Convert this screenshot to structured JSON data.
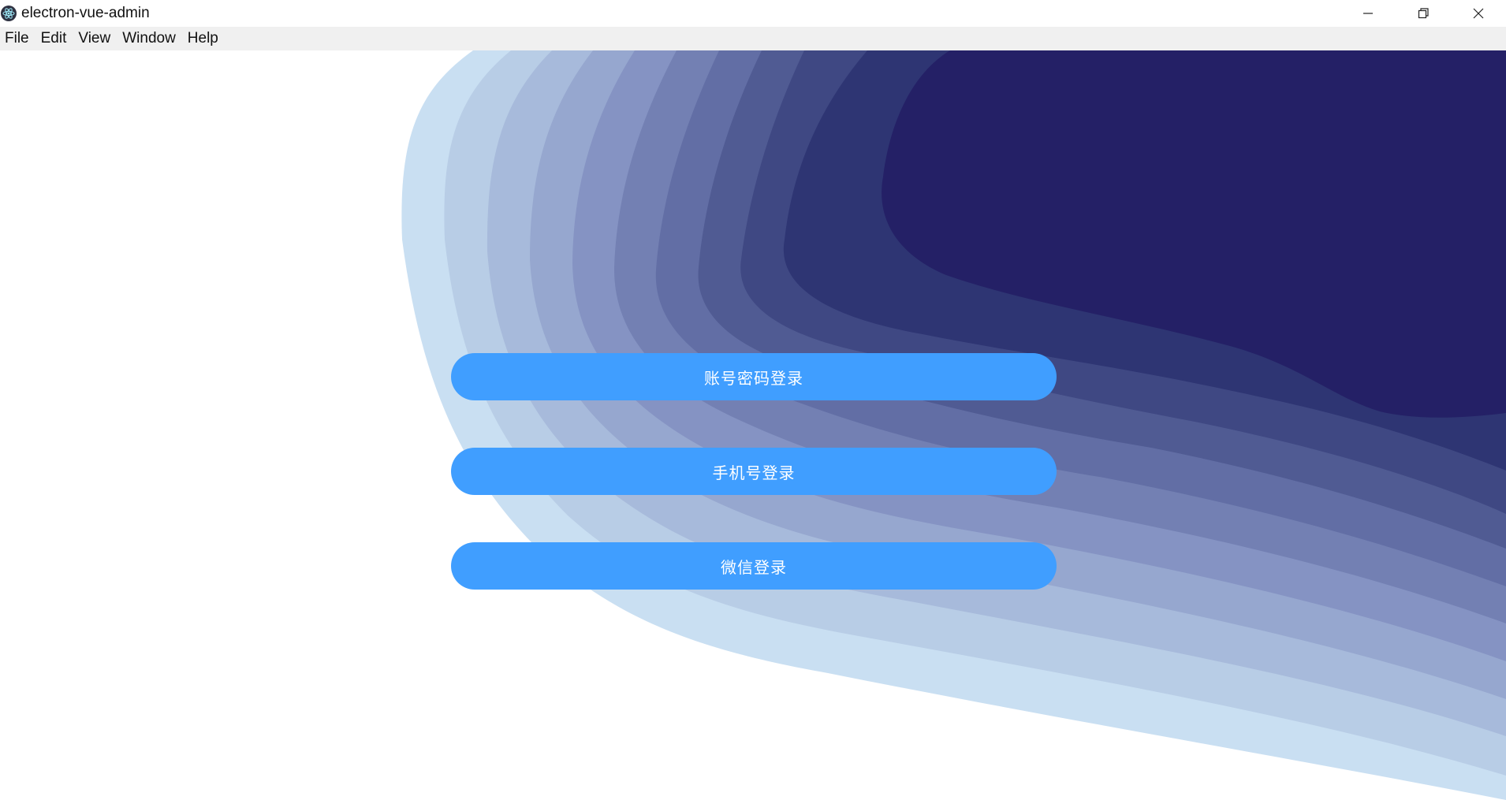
{
  "window": {
    "title": "electron-vue-admin",
    "app_icon": "electron-icon",
    "controls": {
      "minimize_icon": "minimize-icon",
      "restore_icon": "restore-icon",
      "close_icon": "close-icon"
    }
  },
  "menubar": {
    "items": [
      {
        "label": "File"
      },
      {
        "label": "Edit"
      },
      {
        "label": "View"
      },
      {
        "label": "Window"
      },
      {
        "label": "Help"
      }
    ]
  },
  "login": {
    "buttons": [
      {
        "label": "账号密码登录"
      },
      {
        "label": "手机号登录"
      },
      {
        "label": "微信登录"
      }
    ]
  },
  "colors": {
    "button": "#409eff",
    "wave_layers": [
      "#c9dff2",
      "#b8cde6",
      "#a7badb",
      "#96a7cf",
      "#8593c3",
      "#7380b3",
      "#626ea5",
      "#505b93",
      "#3f4883",
      "#2e3573",
      "#242066"
    ]
  }
}
